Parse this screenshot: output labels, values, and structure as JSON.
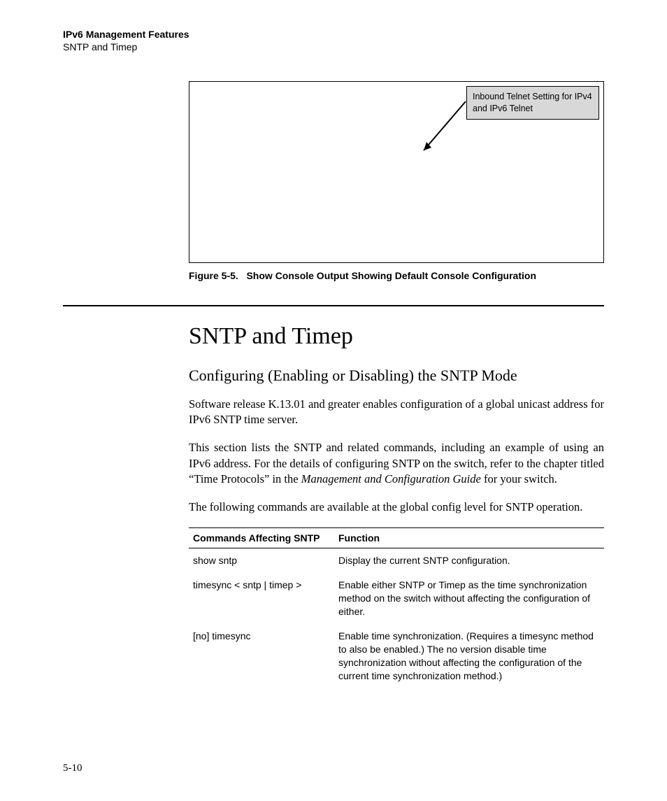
{
  "header": {
    "chapter": "IPv6 Management Features",
    "section": "SNTP and Timep"
  },
  "figure": {
    "callout": "Inbound Telnet Setting for IPv4 and IPv6 Telnet",
    "caption_label": "Figure 5-5.",
    "caption_text": "Show Console Output Showing Default Console Configuration"
  },
  "section_title": "SNTP and Timep",
  "sub_title": "Configuring (Enabling or Disabling) the SNTP Mode",
  "paragraphs": {
    "p1": "Software release K.13.01 and greater enables configuration of a global unicast address for  IPv6 SNTP time server.",
    "p2a": "This section lists the SNTP and related commands, including an example of using an IPv6 address. For the details of configuring SNTP on the switch, refer to the chapter titled “Time Protocols” in the ",
    "p2_italic": "Management and Configuration Guide",
    "p2b": " for your switch.",
    "p3": "The following commands are available at the global config level for SNTP operation."
  },
  "table": {
    "head_cmd": "Commands Affecting SNTP",
    "head_func": "Function",
    "rows": [
      {
        "cmd": "show sntp",
        "func": "Display the current SNTP configuration."
      },
      {
        "cmd": "timesync < sntp | timep >",
        "func": "Enable either SNTP or Timep as the time synchronization method on the switch without affecting the configuration of either."
      },
      {
        "cmd": "[no] timesync",
        "func": "Enable time synchronization. (Requires a timesync method to also be enabled.) The no version disable time synchronization without affecting the configuration of the current time synchronization method.)"
      }
    ]
  },
  "page_number": "5-10"
}
